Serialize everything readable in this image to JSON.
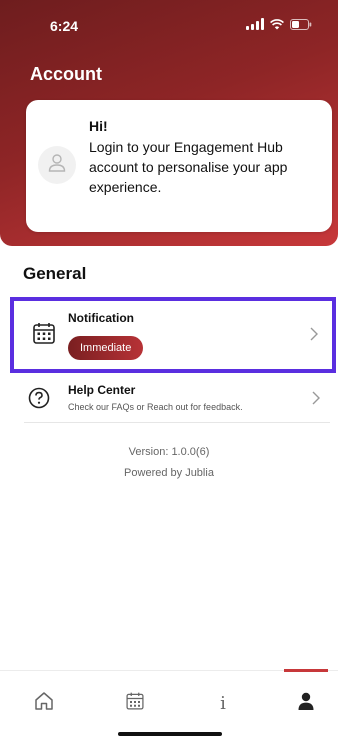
{
  "status_bar": {
    "time": "6:24"
  },
  "header": {
    "title": "Account"
  },
  "login_card": {
    "greeting": "Hi!",
    "message": "Login to your Engagement Hub account to personalise your app experience."
  },
  "general": {
    "title": "General",
    "notification": {
      "title": "Notification",
      "badge": "Immediate"
    },
    "help_center": {
      "title": "Help Center",
      "subtitle": "Check our FAQs or Reach out for feedback."
    }
  },
  "footer": {
    "version": "Version: 1.0.0(6)",
    "powered_by": "Powered by Jublia"
  },
  "tab_bar": {
    "info_label": "i",
    "active_tab": "account"
  },
  "colors": {
    "accent": "#c7383a",
    "header_dark": "#6e1d1e",
    "highlight": "#5a2ee0"
  }
}
